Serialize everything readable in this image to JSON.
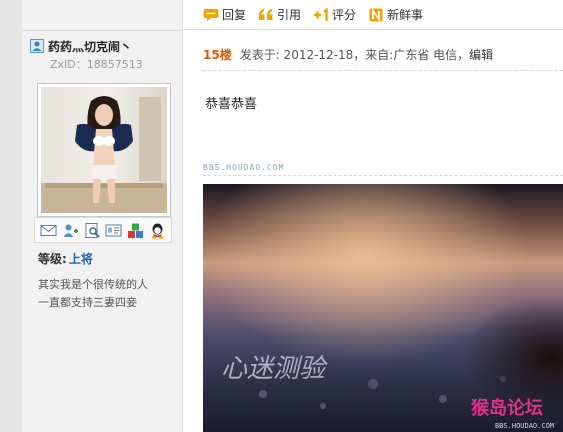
{
  "post": {
    "user": {
      "name": "药药灬切克闹丶",
      "zxid": "ZxID：18857513",
      "level_label": "等级:",
      "level_value": "上将"
    },
    "signature": [
      "其实我是个很传统的人",
      "一直都支持三妻四妾"
    ],
    "actions": [
      {
        "label": "回复",
        "icon": "reply-icon"
      },
      {
        "label": "引用",
        "icon": "quote-icon"
      },
      {
        "label": "评分",
        "icon": "rate-icon"
      },
      {
        "label": "新鲜事",
        "icon": "news-icon"
      }
    ],
    "floor": "15楼",
    "meta": "发表于: 2012-12-18，来自:广东省 电信，",
    "edit_label": "编辑",
    "content": "恭喜恭喜",
    "watermark_small": "BBS.HOUDAO.COM",
    "image_text": "心迷测验",
    "image_logo": "猴岛论坛",
    "image_logo_url": "BBS.HOUDAO.COM"
  },
  "colors": {
    "floor": "#e05a00",
    "level": "#2366a8",
    "action_icon": "#f0a400"
  }
}
